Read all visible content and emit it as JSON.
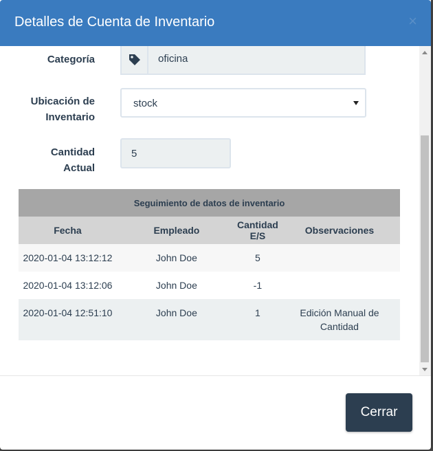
{
  "modal": {
    "title": "Detalles de Cuenta de Inventario",
    "close_symbol": "×"
  },
  "form": {
    "category": {
      "label": "Categoría",
      "value": "oficina",
      "icon": "tag-icon"
    },
    "location": {
      "label_line1": "Ubicación de",
      "label_line2": "Inventario",
      "value": "stock"
    },
    "quantity": {
      "label_line1": "Cantidad",
      "label_line2": "Actual",
      "value": "5"
    }
  },
  "tracking": {
    "title": "Seguimiento de datos de inventario",
    "columns": [
      "Fecha",
      "Empleado",
      "Cantidad E/S",
      "Observaciones"
    ],
    "rows": [
      {
        "date": "2020-01-04 13:12:12",
        "employee": "John Doe",
        "qty": "5",
        "obs": ""
      },
      {
        "date": "2020-01-04 13:12:06",
        "employee": "John Doe",
        "qty": "-1",
        "obs": ""
      },
      {
        "date": "2020-01-04 12:51:10",
        "employee": "John Doe",
        "qty": "1",
        "obs_line1": "Edición Manual de",
        "obs_line2": "Cantidad"
      }
    ]
  },
  "footer": {
    "close_label": "Cerrar"
  },
  "colors": {
    "header": "#3a7bbf",
    "primary_button": "#2c3e50",
    "text": "#2c3e50"
  }
}
